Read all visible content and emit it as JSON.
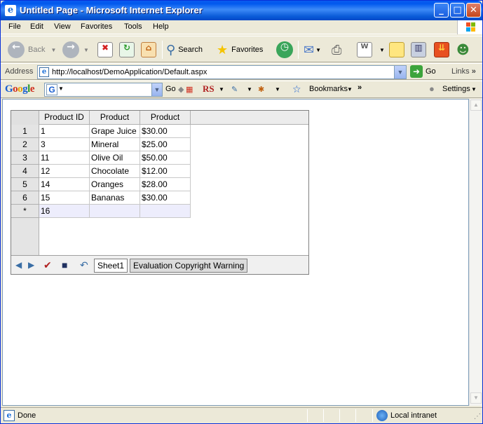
{
  "window": {
    "title": "Untitled Page - Microsoft Internet Explorer"
  },
  "menu": [
    "File",
    "Edit",
    "View",
    "Favorites",
    "Tools",
    "Help"
  ],
  "toolbar": {
    "back": "Back",
    "search": "Search",
    "favorites": "Favorites"
  },
  "address": {
    "label": "Address",
    "url": "http://localhost/DemoApplication/Default.aspx",
    "go": "Go",
    "links": "Links"
  },
  "googlebar": {
    "logo": "Google",
    "go": "Go",
    "rs": "RS",
    "bookmarks": "Bookmarks",
    "settings": "Settings"
  },
  "sheet": {
    "columns": [
      "Product ID",
      "Product",
      "Product"
    ],
    "rows": [
      {
        "num": "1",
        "cells": [
          "1",
          "Grape Juice",
          "$30.00"
        ]
      },
      {
        "num": "2",
        "cells": [
          "3",
          "Mineral",
          "$25.00"
        ]
      },
      {
        "num": "3",
        "cells": [
          "11",
          "Olive Oil",
          "$50.00"
        ]
      },
      {
        "num": "4",
        "cells": [
          "12",
          "Chocolate",
          "$12.00"
        ]
      },
      {
        "num": "5",
        "cells": [
          "14",
          "Oranges",
          "$28.00"
        ]
      },
      {
        "num": "6",
        "cells": [
          "15",
          "Bananas",
          "$30.00"
        ]
      }
    ],
    "new_row": {
      "marker": "*",
      "cells": [
        "16",
        "",
        ""
      ]
    },
    "tabs": {
      "sheet": "Sheet1",
      "warning": "Evaluation Copyright Warning"
    }
  },
  "status": {
    "text": "Done",
    "zone": "Local intranet"
  },
  "colors": {
    "title_bar": "#0058ee",
    "new_row": "#ededfc",
    "chrome": "#ece9d8"
  }
}
